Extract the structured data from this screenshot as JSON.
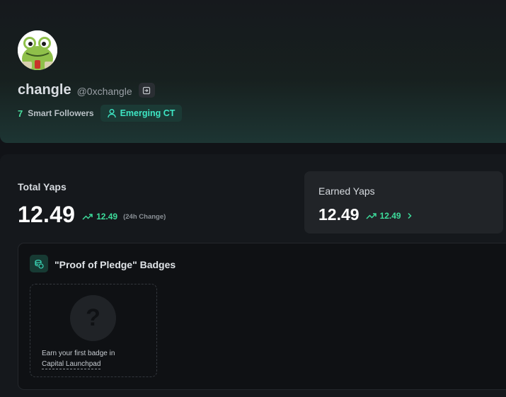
{
  "profile": {
    "avatar_icon": "frog-avatar",
    "display_name": "changle",
    "handle": "@0xchangle",
    "smart_followers_count": "7",
    "smart_followers_label": "Smart Followers",
    "tier_label": "Emerging CT"
  },
  "stats": {
    "total_label": "Total Yaps",
    "total_value": "12.49",
    "total_change": "12.49",
    "total_change_note": "(24h Change)",
    "earned_label": "Earned Yaps",
    "earned_value": "12.49",
    "earned_change": "12.49"
  },
  "badges": {
    "title": "\"Proof of Pledge\" Badges",
    "empty_icon": "question-mark",
    "empty_mark": "?",
    "empty_text": "Earn your first badge in",
    "empty_link": "Capital Launchpad"
  },
  "colors": {
    "accent_green": "#3ddc9b",
    "accent_teal": "#3ee6c4",
    "background": "#111317"
  }
}
